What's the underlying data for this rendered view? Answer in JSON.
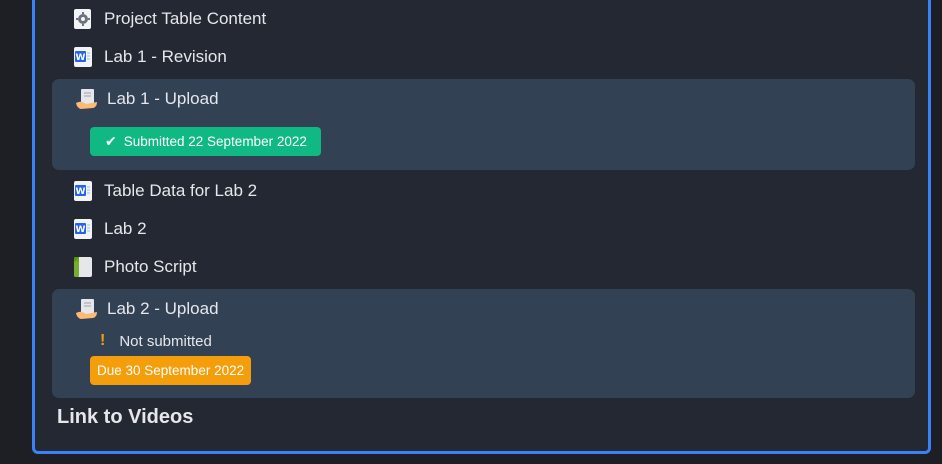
{
  "activities": {
    "project_table_content": {
      "label": "Project Table Content",
      "icon": "settings-file-icon"
    },
    "lab1_revision": {
      "label": "Lab 1 - Revision",
      "icon": "word-document-icon"
    },
    "table_data_lab2": {
      "label": "Table Data for Lab 2",
      "icon": "word-document-icon"
    },
    "lab2": {
      "label": "Lab 2",
      "icon": "word-document-icon"
    },
    "photo_script": {
      "label": "Photo Script",
      "icon": "generic-file-icon"
    }
  },
  "assignments": {
    "lab1_upload": {
      "label": "Lab 1 - Upload",
      "icon": "assignment-upload-icon",
      "status": "Submitted 22 September 2022",
      "status_color": "#10b981"
    },
    "lab2_upload": {
      "label": "Lab 2 - Upload",
      "icon": "assignment-upload-icon",
      "status": "Not submitted",
      "due": "Due 30 September 2022",
      "due_color": "#f59e0b"
    }
  },
  "next_section": {
    "title": "Link to Videos"
  },
  "colors": {
    "accent_border": "#3b82f6",
    "card_bg": "#334155",
    "panel_bg": "#242832"
  }
}
